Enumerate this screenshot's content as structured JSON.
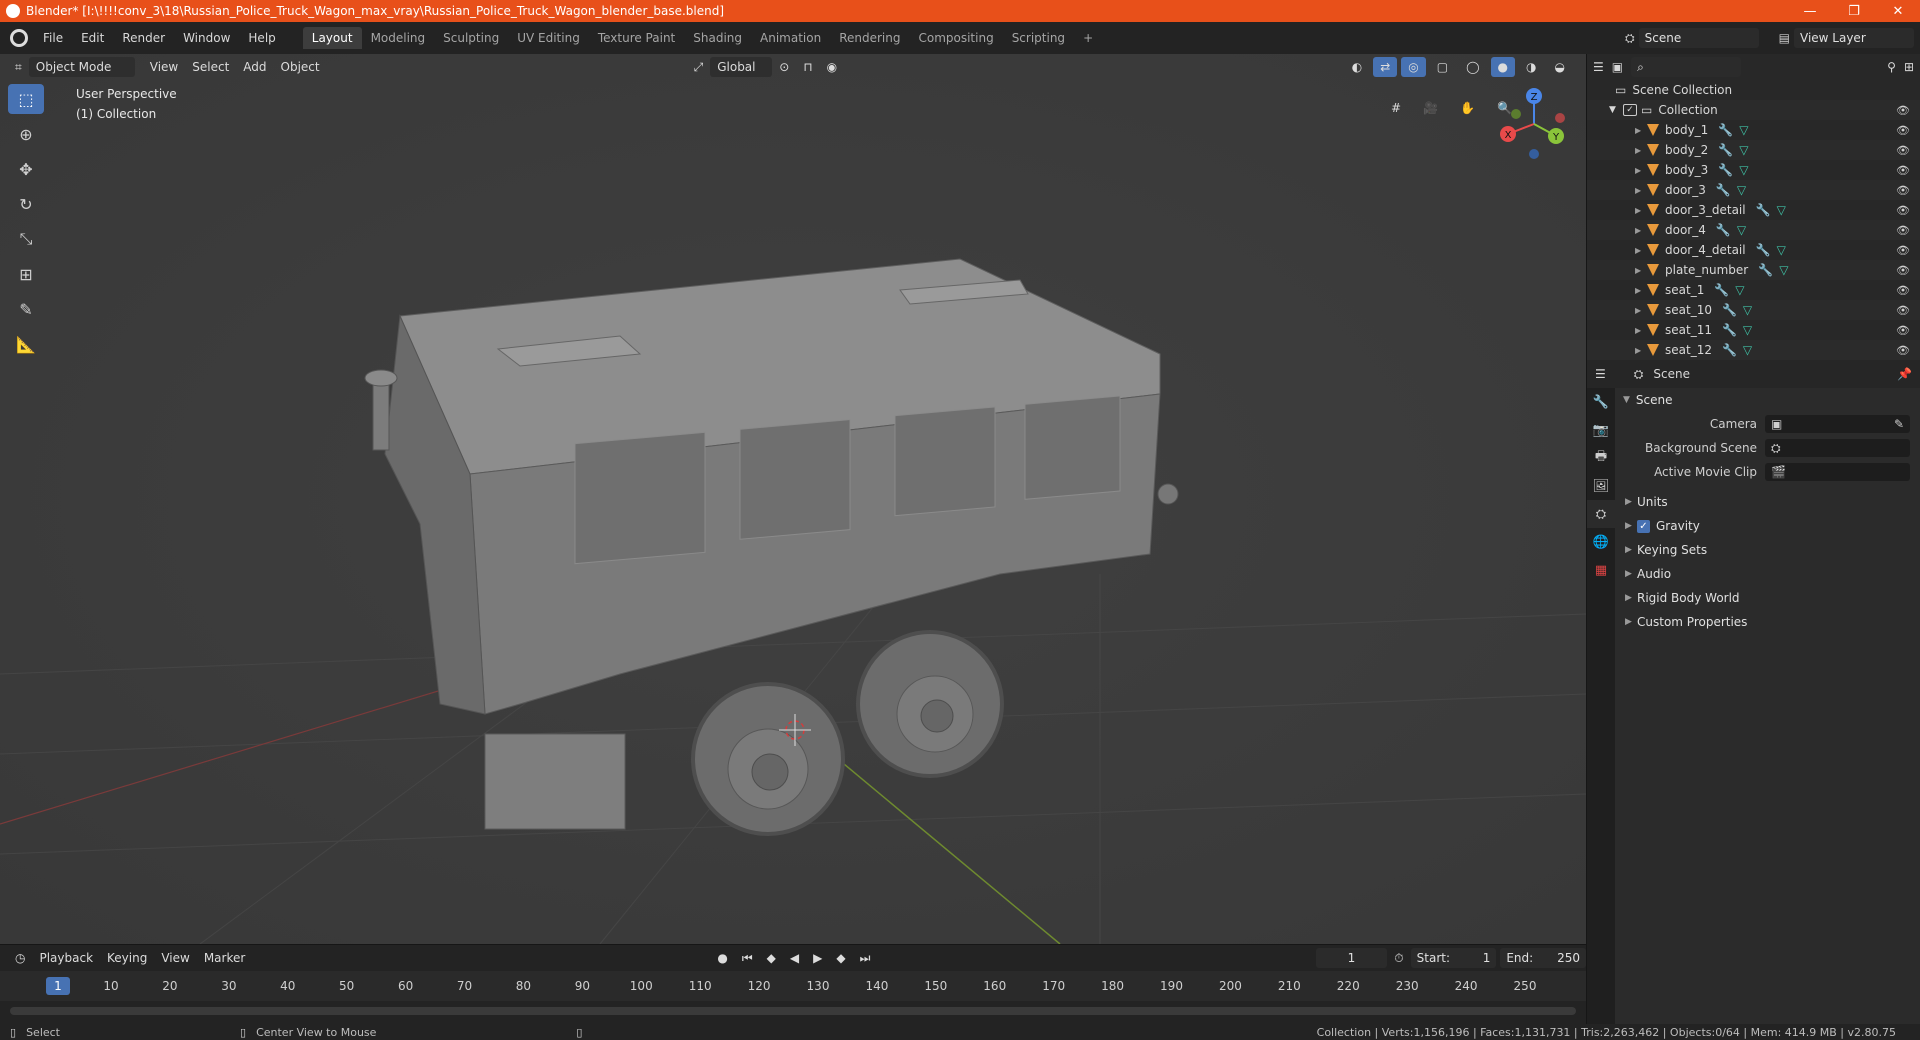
{
  "window": {
    "title": "Blender* [I:\\!!!!conv_3\\18\\Russian_Police_Truck_Wagon_max_vray\\Russian_Police_Truck_Wagon_blender_base.blend]",
    "minimize": "—",
    "maximize": "❐",
    "close": "✕"
  },
  "menu": [
    "File",
    "Edit",
    "Render",
    "Window",
    "Help"
  ],
  "workspaces": [
    "Layout",
    "Modeling",
    "Sculpting",
    "UV Editing",
    "Texture Paint",
    "Shading",
    "Animation",
    "Rendering",
    "Compositing",
    "Scripting"
  ],
  "active_workspace": "Layout",
  "top_right": {
    "scene": "Scene",
    "view_layer": "View Layer"
  },
  "viewport": {
    "mode": "Object Mode",
    "menus": [
      "View",
      "Select",
      "Add",
      "Object"
    ],
    "orientation": "Global",
    "info_line1": "User Perspective",
    "info_line2": "(1) Collection",
    "gizmo_axes": {
      "x": "X",
      "y": "Y",
      "z": "Z"
    }
  },
  "tools": [
    "select-box-icon",
    "cursor-icon",
    "move-icon",
    "rotate-icon",
    "scale-icon",
    "transform-icon",
    "annotate-icon",
    "measure-icon"
  ],
  "outliner": {
    "root": "Scene Collection",
    "collection": "Collection",
    "items": [
      "body_1",
      "body_2",
      "body_3",
      "door_3",
      "door_3_detail",
      "door_4",
      "door_4_detail",
      "plate_number",
      "seat_1",
      "seat_10",
      "seat_11",
      "seat_12"
    ]
  },
  "properties": {
    "header": "Scene",
    "panel": "Scene",
    "fields": [
      {
        "label": "Camera",
        "value": ""
      },
      {
        "label": "Background Scene",
        "value": ""
      },
      {
        "label": "Active Movie Clip",
        "value": ""
      }
    ],
    "subpanels": [
      "Units",
      "Gravity",
      "Keying Sets",
      "Audio",
      "Rigid Body World",
      "Custom Properties"
    ]
  },
  "timeline": {
    "menus": [
      "Playback",
      "Keying",
      "View",
      "Marker"
    ],
    "current_frame": "1",
    "start_label": "Start:",
    "start": "1",
    "end_label": "End:",
    "end": "250",
    "ticks": [
      "1",
      "10",
      "20",
      "30",
      "40",
      "50",
      "60",
      "70",
      "80",
      "90",
      "100",
      "110",
      "120",
      "130",
      "140",
      "150",
      "160",
      "170",
      "180",
      "190",
      "200",
      "210",
      "220",
      "230",
      "240",
      "250"
    ]
  },
  "status": {
    "left1": "Select",
    "left2": "Center View to Mouse",
    "right": "Collection | Verts:1,156,196 | Faces:1,131,731 | Tris:2,263,462 | Objects:0/64 | Mem: 414.9 MB | v2.80.75"
  },
  "colors": {
    "accent": "#4772b3",
    "title_bar": "#e8501a",
    "mesh_icon": "#e89a3c"
  }
}
